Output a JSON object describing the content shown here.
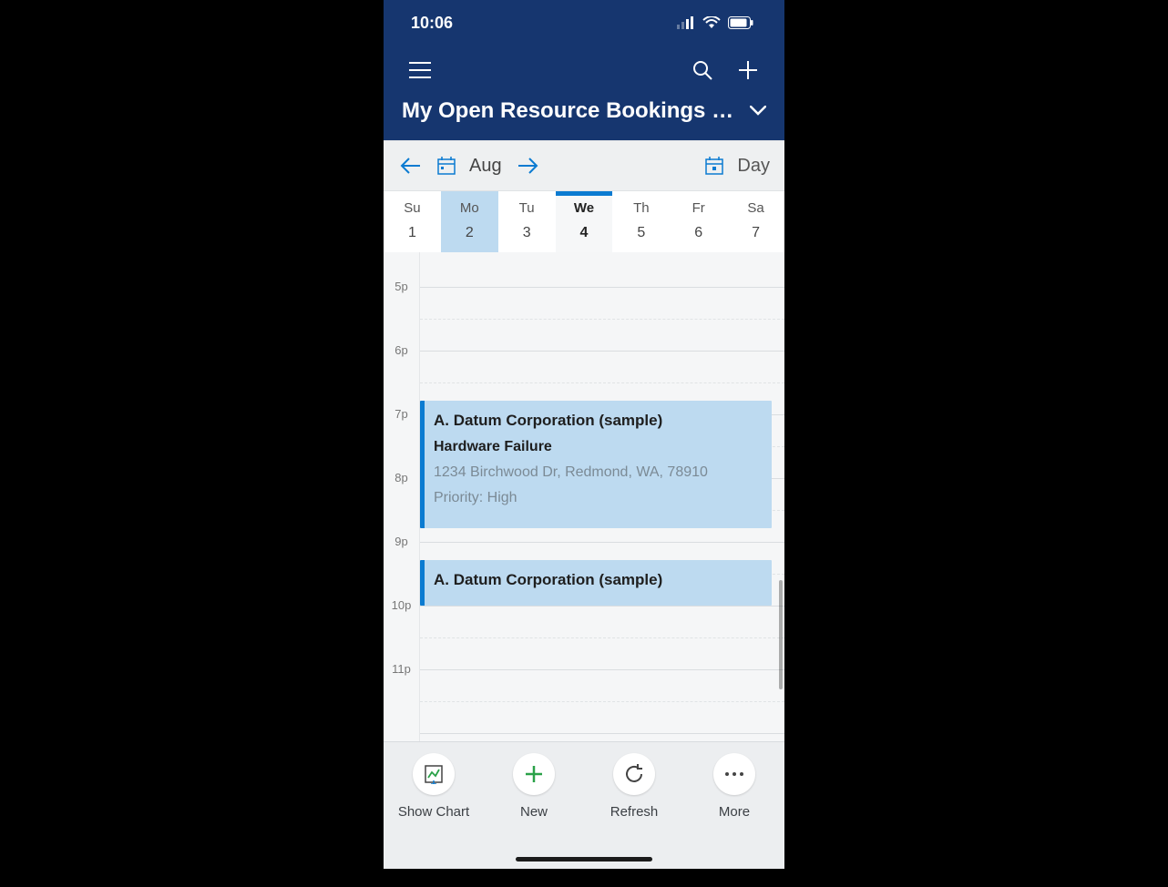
{
  "statusbar": {
    "time": "10:06"
  },
  "appbar": {},
  "title": "My Open Resource Bookings (Fiel...",
  "datenav": {
    "month": "Aug",
    "view": "Day"
  },
  "week": {
    "days": [
      {
        "d": "Su",
        "n": "1"
      },
      {
        "d": "Mo",
        "n": "2"
      },
      {
        "d": "Tu",
        "n": "3"
      },
      {
        "d": "We",
        "n": "4"
      },
      {
        "d": "Th",
        "n": "5"
      },
      {
        "d": "Fr",
        "n": "6"
      },
      {
        "d": "Sa",
        "n": "7"
      }
    ]
  },
  "hours": [
    "5p",
    "6p",
    "7p",
    "8p",
    "9p",
    "10p",
    "11p"
  ],
  "events": [
    {
      "title": "A. Datum Corporation (sample)",
      "subtitle": "Hardware Failure",
      "address": "1234 Birchwood Dr, Redmond, WA, 78910",
      "priority": "Priority: High"
    },
    {
      "title": "A. Datum Corporation (sample)"
    }
  ],
  "bottombar": {
    "showchart": "Show Chart",
    "new": "New",
    "refresh": "Refresh",
    "more": "More"
  }
}
